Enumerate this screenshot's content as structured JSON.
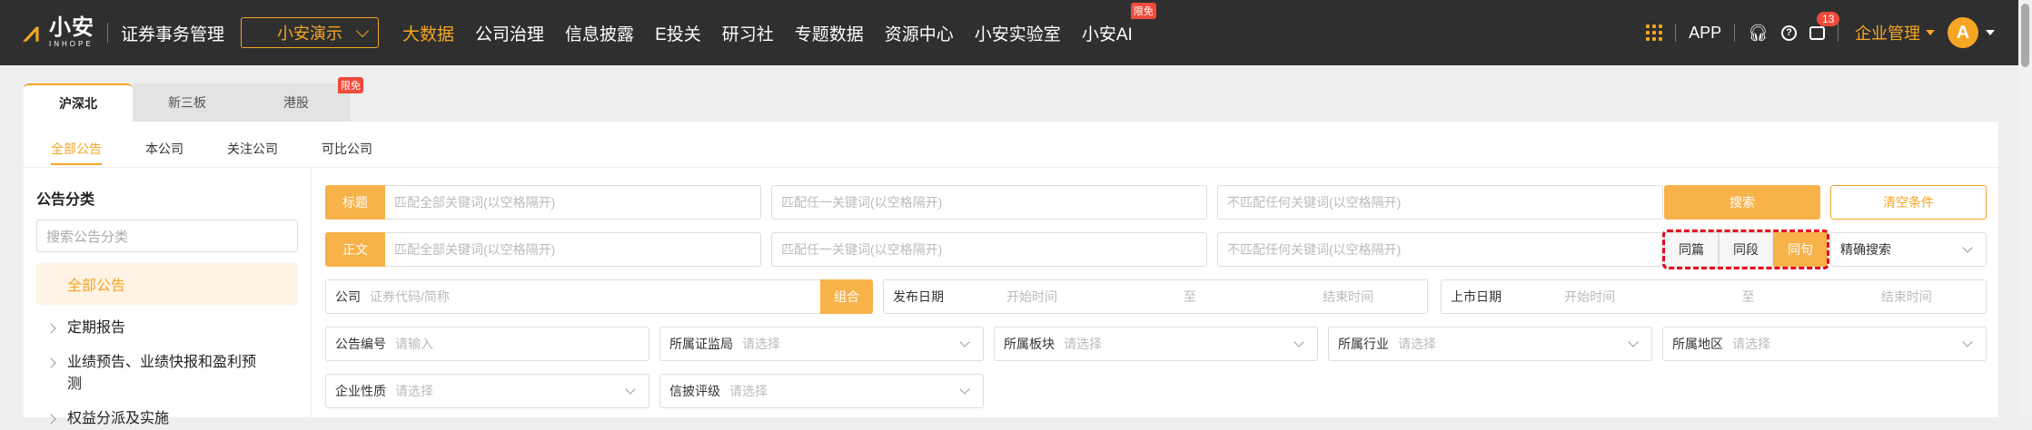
{
  "topbar": {
    "logo_name": "小安",
    "logo_sub": "INHOPE",
    "app_title": "证券事务管理",
    "demo_select": "小安演示",
    "nav": [
      {
        "label": "大数据",
        "active": true
      },
      {
        "label": "公司治理"
      },
      {
        "label": "信息披露"
      },
      {
        "label": "E投关"
      },
      {
        "label": "研习社"
      },
      {
        "label": "专题数据"
      },
      {
        "label": "资源中心"
      },
      {
        "label": "小安实验室"
      },
      {
        "label": "小安AI",
        "badge": "限免"
      }
    ],
    "app_label": "APP",
    "notify_count": "13",
    "enterprise": "企业管理",
    "avatar_letter": "A"
  },
  "market_tabs": [
    {
      "label": "沪深北",
      "active": true
    },
    {
      "label": "新三板"
    },
    {
      "label": "港股",
      "badge": "限免"
    }
  ],
  "sub_tabs": [
    {
      "label": "全部公告",
      "active": true
    },
    {
      "label": "本公司"
    },
    {
      "label": "关注公司"
    },
    {
      "label": "可比公司"
    }
  ],
  "sidebar": {
    "title": "公告分类",
    "search_placeholder": "搜索公告分类",
    "all_label": "全部公告",
    "items": [
      {
        "line1": "定期报告"
      },
      {
        "line1": "业绩预告、业绩快报和盈利预",
        "line2": "测"
      },
      {
        "line1": "权益分派及实施"
      }
    ]
  },
  "filters": {
    "title_label": "标题",
    "body_label": "正文",
    "match_all_ph": "匹配全部关键词(以空格隔开)",
    "match_any_ph": "匹配任一关键词(以空格隔开)",
    "match_none_ph": "不匹配任何关键词(以空格隔开)",
    "search_btn": "搜索",
    "clear_btn": "清空条件",
    "seg": [
      "同篇",
      "同段",
      "同句"
    ],
    "seg_active": "同句",
    "precise_label": "精确搜索",
    "company_label": "公司",
    "company_ph": "证券代码/简称",
    "combo_btn": "组合",
    "pub_date_label": "发布日期",
    "list_date_label": "上市日期",
    "start_ph": "开始时间",
    "to_label": "至",
    "end_ph": "结束时间",
    "notice_no_label": "公告编号",
    "notice_no_ph": "请输入",
    "regulator_label": "所属证监局",
    "board_label": "所属板块",
    "industry_label": "所属行业",
    "region_label": "所属地区",
    "nature_label": "企业性质",
    "rating_label": "信披评级",
    "select_ph": "请选择"
  }
}
